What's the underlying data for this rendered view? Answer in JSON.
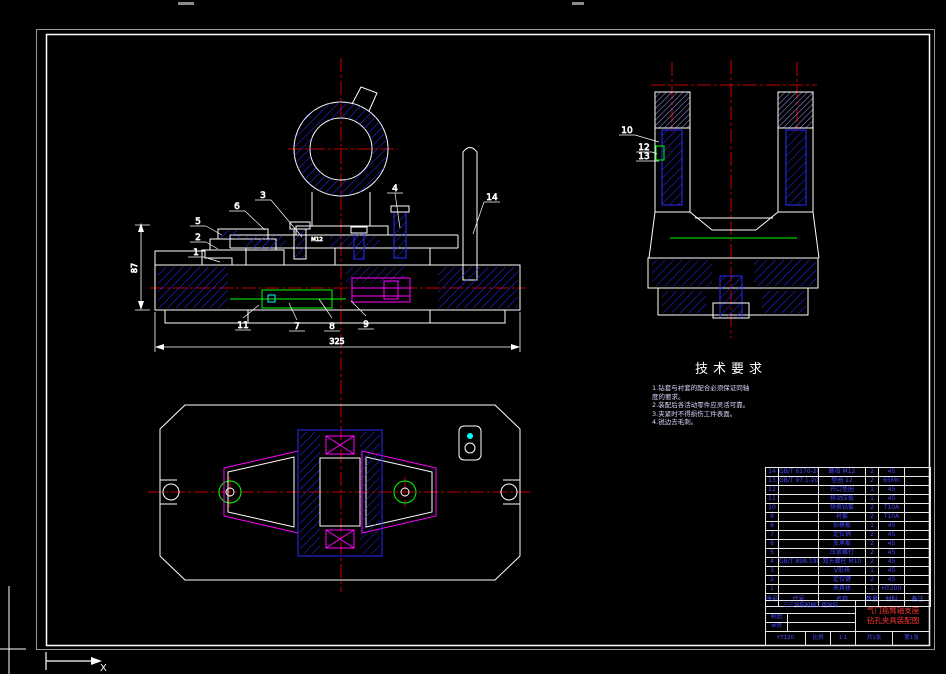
{
  "app": {
    "background": "#000000"
  },
  "colors": {
    "outline": "#ffffff",
    "section_hatch": "#2a2aff",
    "hidden_line": "#ff00ff",
    "center_line": "#ff0000",
    "aux_line": "#00ff00",
    "highlight": "#00ffff",
    "table_text": "#4646ff",
    "title_red": "#ff3333"
  },
  "balloons": {
    "b1": "1",
    "b2": "2",
    "b3": "3",
    "b4": "4",
    "b5": "5",
    "b6": "6",
    "b7": "7",
    "b8": "8",
    "b9": "9",
    "b10": "10",
    "b11": "11",
    "b12": "12",
    "b13": "13",
    "b14": "14"
  },
  "dims": {
    "base_width": "325",
    "base_height": "87",
    "bolt_label": "M12"
  },
  "tech_req": {
    "title": "技术要求",
    "lines": [
      "1.钻套与衬套的配合必须保证同轴",
      "  度的要求。",
      "2.装配后各活动零件应灵活可靠。",
      "3.夹紧时不得损伤工件表面。",
      "4.锐边去毛刺。"
    ]
  },
  "bom": {
    "headers": [
      "序号",
      "代号",
      "名称",
      "数量",
      "材料",
      "备注"
    ],
    "rows": [
      {
        "seq": "14",
        "code": "GB/T 6170-2000",
        "name": "螺母 M12",
        "qty": "2",
        "mat": "45",
        "note": ""
      },
      {
        "seq": "13",
        "code": "GB/T 97.1-2002",
        "name": "垫圈 12",
        "qty": "2",
        "mat": "65Mn",
        "note": ""
      },
      {
        "seq": "12",
        "code": "",
        "name": "开口垫圈",
        "qty": "1",
        "mat": "45",
        "note": ""
      },
      {
        "seq": "11",
        "code": "",
        "name": "移动压板",
        "qty": "1",
        "mat": "45",
        "note": ""
      },
      {
        "seq": "10",
        "code": "",
        "name": "快换钻套",
        "qty": "2",
        "mat": "T10A",
        "note": ""
      },
      {
        "seq": "9",
        "code": "",
        "name": "衬套",
        "qty": "2",
        "mat": "T10A",
        "note": ""
      },
      {
        "seq": "8",
        "code": "",
        "name": "钻模板",
        "qty": "1",
        "mat": "45",
        "note": ""
      },
      {
        "seq": "7",
        "code": "",
        "name": "定位销",
        "qty": "2",
        "mat": "45",
        "note": ""
      },
      {
        "seq": "6",
        "code": "",
        "name": "支承板",
        "qty": "2",
        "mat": "45",
        "note": ""
      },
      {
        "seq": "5",
        "code": "",
        "name": "压紧螺钉",
        "qty": "2",
        "mat": "45",
        "note": ""
      },
      {
        "seq": "4",
        "code": "GB/T 898-1988",
        "name": "双头螺柱 M10",
        "qty": "2",
        "mat": "45",
        "note": ""
      },
      {
        "seq": "3",
        "code": "",
        "name": "V形块",
        "qty": "1",
        "mat": "45",
        "note": ""
      },
      {
        "seq": "2",
        "code": "",
        "name": "定位键",
        "qty": "2",
        "mat": "45",
        "note": ""
      },
      {
        "seq": "1",
        "code": "",
        "name": "夹具体",
        "qty": "1",
        "mat": "HT200",
        "note": ""
      }
    ]
  },
  "title_block": {
    "org": "三江学院机械工程学院",
    "title_line1": "气门摇臂轴支座",
    "title_line2": "钻孔夹具装配图",
    "draw_label": "制图",
    "check_label": "审核",
    "code": "YT120",
    "scale_label": "比例",
    "scale_value": "1:1",
    "sheet1": "共1张",
    "sheet2": "第1张"
  },
  "ucs": {
    "x_label": "X"
  }
}
